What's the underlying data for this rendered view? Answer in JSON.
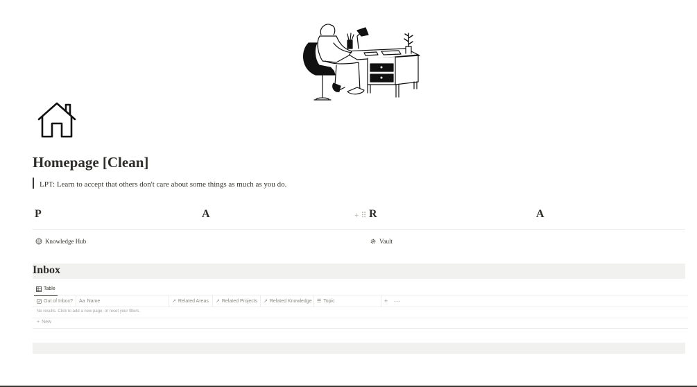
{
  "page": {
    "title": "Homepage [Clean]",
    "icon": "house-icon",
    "cover": "person-at-desk-illustration",
    "callout": "LPT: Learn to accept that others don't care about some things as much as you do."
  },
  "columns": {
    "headings": [
      "P",
      "A",
      "R",
      "A"
    ],
    "links": [
      {
        "label": "Knowledge Hub",
        "icon": "brain-icon"
      },
      {
        "label": "Vault",
        "icon": "gear-icon"
      }
    ]
  },
  "inbox": {
    "title": "Inbox",
    "view_tab": {
      "label": "Table",
      "icon": "table-icon"
    },
    "headers": [
      {
        "label": "Out of Inbox?",
        "icon": "checkbox-icon"
      },
      {
        "label": "Name",
        "icon": "text-icon"
      },
      {
        "label": "Related Areas",
        "icon": "arrow-ne-icon"
      },
      {
        "label": "Related Projects",
        "icon": "arrow-ne-icon"
      },
      {
        "label": "Related Knowledge",
        "icon": "arrow-ne-icon"
      },
      {
        "label": "Topic",
        "icon": "list-icon"
      }
    ],
    "empty_text": "No results. Click to add a new page, or reset your filters.",
    "new_label": "New"
  }
}
